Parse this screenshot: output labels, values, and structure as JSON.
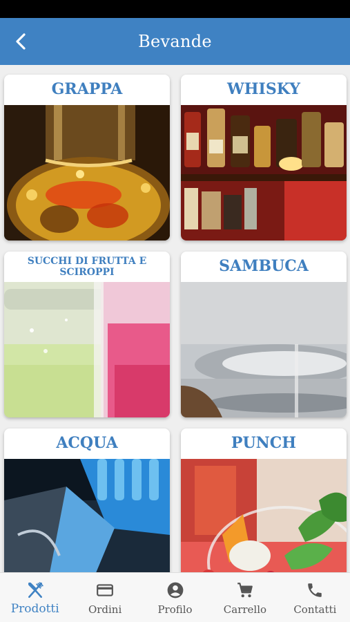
{
  "header": {
    "title": "Bevande",
    "back_icon": "back-arrow-icon"
  },
  "categories": [
    {
      "label": "GRAPPA",
      "image": "grappa-photo"
    },
    {
      "label": "WHISKY",
      "image": "whisky-photo"
    },
    {
      "label": "SUCCHI DI FRUTTA E SCIROPPI",
      "image": "juice-photo"
    },
    {
      "label": "SAMBUCA",
      "image": "sambuca-photo"
    },
    {
      "label": "ACQUA",
      "image": "water-photo"
    },
    {
      "label": "PUNCH",
      "image": "punch-photo"
    }
  ],
  "bottom_nav": {
    "active": "Prodotti",
    "items": [
      {
        "label": "Prodotti",
        "icon": "fork-knife-icon"
      },
      {
        "label": "Ordini",
        "icon": "credit-card-icon"
      },
      {
        "label": "Profilo",
        "icon": "account-icon"
      },
      {
        "label": "Carrello",
        "icon": "cart-icon"
      },
      {
        "label": "Contatti",
        "icon": "phone-icon"
      }
    ]
  },
  "colors": {
    "primary": "#3f82c3",
    "card_title": "#3f7fbf",
    "background": "#efefef"
  }
}
